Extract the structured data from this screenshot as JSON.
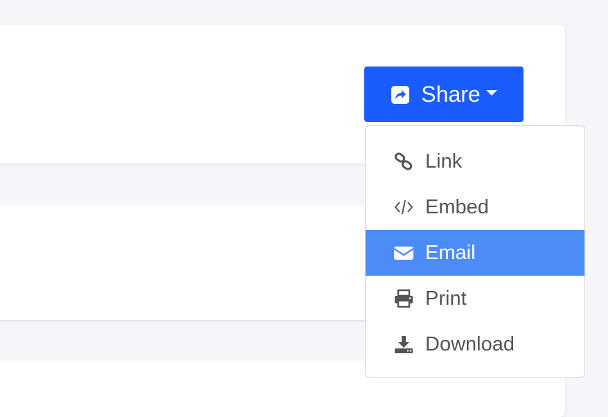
{
  "share_button": {
    "label": "Share",
    "icon": "share-square-icon"
  },
  "menu": {
    "items": [
      {
        "label": "Link",
        "icon": "link-icon",
        "active": false
      },
      {
        "label": "Embed",
        "icon": "code-icon",
        "active": false
      },
      {
        "label": "Email",
        "icon": "envelope-icon",
        "active": true
      },
      {
        "label": "Print",
        "icon": "printer-icon",
        "active": false
      },
      {
        "label": "Download",
        "icon": "download-icon",
        "active": false
      }
    ]
  },
  "colors": {
    "primary": "#1a5cff",
    "active_item": "#4b8cf7",
    "menu_text": "#555555",
    "page_background": "#f5f6fa"
  }
}
